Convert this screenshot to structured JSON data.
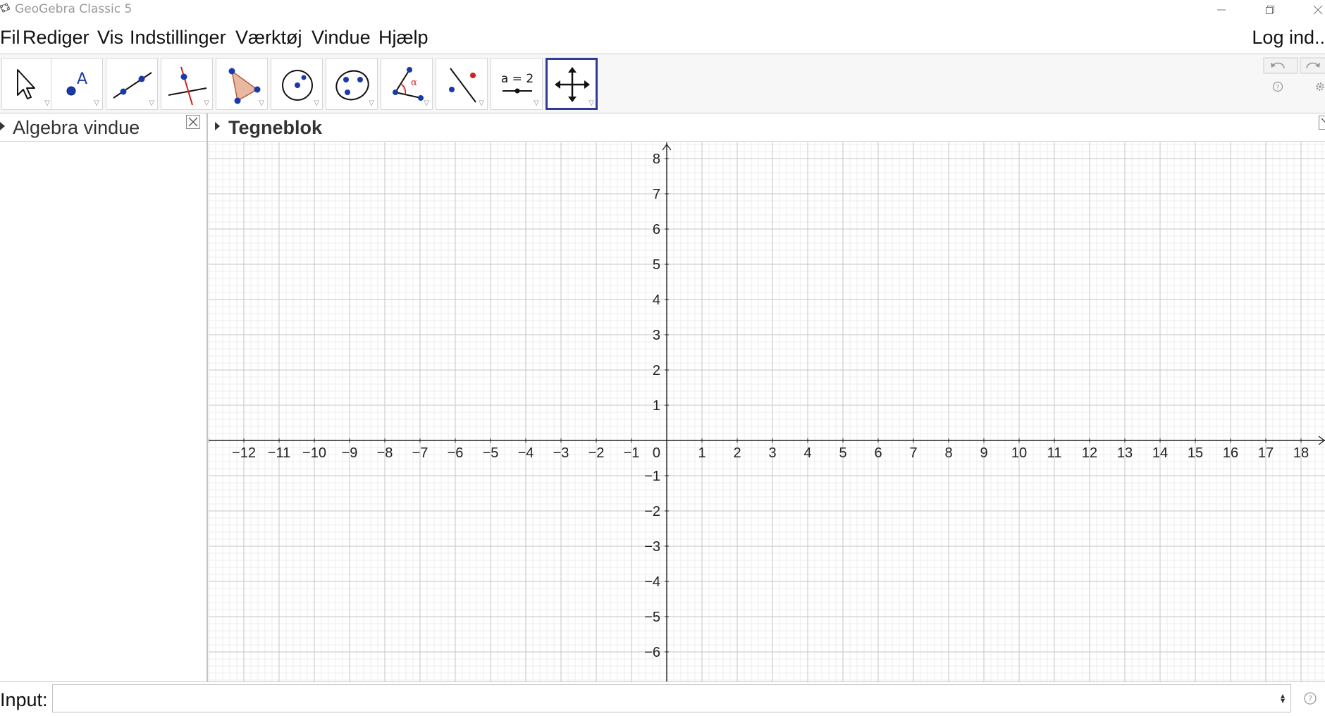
{
  "window": {
    "title": "GeoGebra Classic 5"
  },
  "menubar": {
    "items": [
      "Fil",
      "Rediger",
      "Vis",
      "Indstillinger",
      "Værktøj",
      "Vindue",
      "Hjælp"
    ],
    "login": "Log ind.."
  },
  "toolbar": {
    "tools": [
      {
        "name": "move-tool",
        "icon": "arrow-cursor-icon"
      },
      {
        "name": "point-tool",
        "icon": "point-a-icon"
      },
      {
        "name": "line-tool",
        "icon": "line-through-two-points-icon"
      },
      {
        "name": "perpendicular-line-tool",
        "icon": "perpendicular-line-icon"
      },
      {
        "name": "polygon-tool",
        "icon": "polygon-icon"
      },
      {
        "name": "circle-tool",
        "icon": "circle-center-point-icon"
      },
      {
        "name": "conic-tool",
        "icon": "ellipse-icon"
      },
      {
        "name": "angle-tool",
        "icon": "angle-alpha-icon"
      },
      {
        "name": "reflect-tool",
        "icon": "reflect-line-icon"
      },
      {
        "name": "slider-tool",
        "icon": "slider-icon",
        "label": "a = 2"
      },
      {
        "name": "move-graphics-view-tool",
        "icon": "move-cross-arrows-icon",
        "selected": true
      }
    ]
  },
  "algebra": {
    "title": "Algebra vindue"
  },
  "graphics": {
    "title": "Tegneblok",
    "x_ticks": [
      "−12",
      "−11",
      "−10",
      "−9",
      "−8",
      "−7",
      "−6",
      "−5",
      "−4",
      "−3",
      "−2",
      "−1",
      "0",
      "1",
      "2",
      "3",
      "4",
      "5",
      "6",
      "7",
      "8",
      "9",
      "10",
      "11",
      "12",
      "13",
      "14",
      "15",
      "16",
      "17",
      "18"
    ],
    "y_ticks_pos": [
      "1",
      "2",
      "3",
      "4",
      "5",
      "6",
      "7",
      "8"
    ],
    "y_ticks_neg": [
      "−1",
      "−2",
      "−3",
      "−4",
      "−5",
      "−6"
    ],
    "x_range": [
      -13,
      19
    ],
    "y_range": [
      -7,
      8.4
    ],
    "grid": true,
    "colors": {
      "major_grid": "#c6c6c6",
      "minor_grid": "#ececec",
      "axis": "#222222"
    }
  },
  "inputbar": {
    "label": "Input:",
    "value": ""
  },
  "colors": {
    "selected_tool_border": "#2e3b9a",
    "point_blue": "#1a3aa8",
    "toolbar_bg": "#f7f7f7"
  }
}
